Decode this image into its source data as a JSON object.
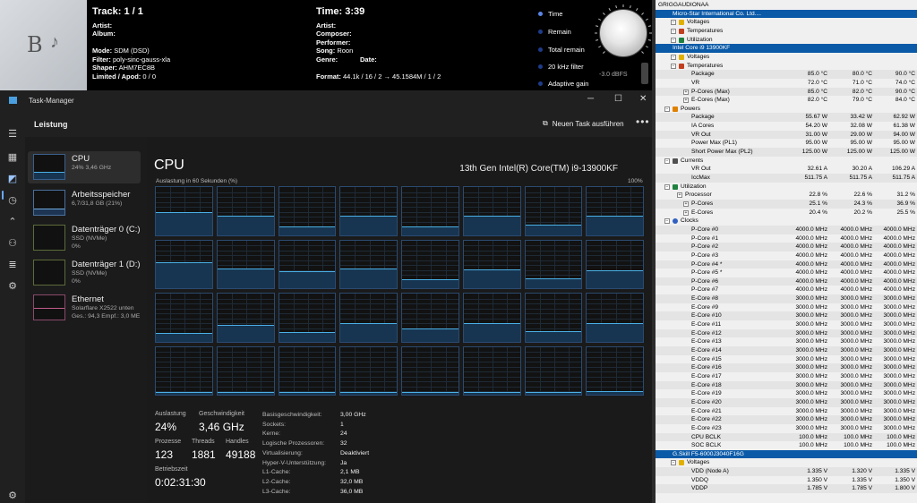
{
  "player": {
    "track_label": "Track:",
    "track_value": "1 / 1",
    "artist_label": "Artist:",
    "album_label": "Album:",
    "mode_label": "Mode:",
    "mode_value": "SDM (DSD)",
    "filter_label": "Filter:",
    "filter_value": "poly-sinc-gauss-xla",
    "shaper_label": "Shaper:",
    "shaper_value": "AHM7EC8B",
    "limited_label": "Limited / Apod:",
    "limited_value": "0 / 0",
    "time_label": "Time:",
    "time_value": "3:39",
    "composer_label": "Composer:",
    "performer_label": "Performer:",
    "song_label": "Song:",
    "song_value": "Roon",
    "genre_label": "Genre:",
    "date_label": "Date:",
    "format_label": "Format:",
    "format_value": "44.1k / 16 / 2 → 45.1584M / 1 / 2",
    "options": [
      "Time",
      "Remain",
      "Total remain",
      "20 kHz filter",
      "Adaptive gain"
    ],
    "selected_option_index": 0,
    "volume_text": "-3.0 dBFS"
  },
  "taskmanager": {
    "window_title": "Task-Manager",
    "section_title": "Leistung",
    "new_task_label": "Neuen Task ausführen",
    "more_label": "•••",
    "resources": [
      {
        "name": "CPU",
        "sub1": "24% 3,46 GHz",
        "sub2": ""
      },
      {
        "name": "Arbeitsspeicher",
        "sub1": "6,7/31,8 GB (21%)",
        "sub2": ""
      },
      {
        "name": "Datenträger 0 (C:)",
        "sub1": "SSD (NVMe)",
        "sub2": "0%"
      },
      {
        "name": "Datenträger 1 (D:)",
        "sub1": "SSD (NVMe)",
        "sub2": "0%"
      },
      {
        "name": "Ethernet",
        "sub1": "Solarflare X2522 unten",
        "sub2": "Ges.: 94,3 Empf.: 3,0 ME"
      }
    ],
    "cpu_title": "CPU",
    "cpu_model": "13th Gen Intel(R) Core(TM) i9-13900KF",
    "graph_caption": "Auslastung in 60 Sekunden (%)",
    "graph_max": "100%",
    "core_loads": [
      48,
      40,
      18,
      40,
      18,
      40,
      22,
      40,
      55,
      42,
      35,
      42,
      18,
      40,
      20,
      38,
      18,
      35,
      20,
      38,
      28,
      38,
      22,
      38,
      5,
      6,
      5,
      6,
      5,
      5,
      6,
      7
    ],
    "stats": {
      "util_label": "Auslastung",
      "util_value": "24%",
      "speed_label": "Geschwindigkeit",
      "speed_value": "3,46 GHz",
      "proc_label": "Prozesse",
      "proc_value": "123",
      "threads_label": "Threads",
      "threads_value": "1881",
      "handles_label": "Handles",
      "handles_value": "49188",
      "uptime_label": "Betriebszeit",
      "uptime_value": "0:02:31:30"
    },
    "specs": [
      {
        "label": "Basisgeschwindigkeit:",
        "value": "3,00 GHz"
      },
      {
        "label": "Sockets:",
        "value": "1"
      },
      {
        "label": "Kerne:",
        "value": "24"
      },
      {
        "label": "Logische Prozessoren:",
        "value": "32"
      },
      {
        "label": "Virtualisierung:",
        "value": "Deaktiviert"
      },
      {
        "label": "Hyper-V-Unterstützung:",
        "value": "Ja"
      },
      {
        "label": "L1-Cache:",
        "value": "2,1 MB"
      },
      {
        "label": "L2-Cache:",
        "value": "32,0 MB"
      },
      {
        "label": "L3-Cache:",
        "value": "36,0 MB"
      }
    ]
  },
  "hwinfo": {
    "rows": [
      {
        "name": "GRIGGAUDIONAA",
        "indent": 0,
        "kind": "root"
      },
      {
        "name": "Micro-Star International Co. Ltd....",
        "indent": 1,
        "kind": "sel"
      },
      {
        "name": "Voltages",
        "indent": 2,
        "kind": "group",
        "icon": "bolt-icon"
      },
      {
        "name": "Temperatures",
        "indent": 2,
        "kind": "group",
        "icon": "thermometer-icon"
      },
      {
        "name": "Utilization",
        "indent": 2,
        "kind": "group",
        "icon": "chip-icon"
      },
      {
        "name": "Intel Core i9 13900KF",
        "indent": 1,
        "kind": "sel"
      },
      {
        "name": "Voltages",
        "indent": 2,
        "kind": "group",
        "icon": "bolt-icon"
      },
      {
        "name": "Temperatures",
        "indent": 2,
        "kind": "group",
        "icon": "thermometer-icon"
      },
      {
        "name": "Package",
        "indent": 4,
        "v": [
          "85.0 °C",
          "80.0 °C",
          "90.0 °C"
        ]
      },
      {
        "name": "VR",
        "indent": 4,
        "v": [
          "72.0 °C",
          "71.0 °C",
          "74.0 °C"
        ]
      },
      {
        "name": "P-Cores (Max)",
        "indent": 4,
        "exp": true,
        "v": [
          "85.0 °C",
          "82.0 °C",
          "90.0 °C"
        ]
      },
      {
        "name": "E-Cores (Max)",
        "indent": 4,
        "exp": true,
        "v": [
          "82.0 °C",
          "79.0 °C",
          "84.0 °C"
        ]
      },
      {
        "name": "Powers",
        "indent": 1,
        "kind": "group",
        "icon": "power-icon"
      },
      {
        "name": "Package",
        "indent": 4,
        "v": [
          "55.67 W",
          "33.42 W",
          "62.92 W"
        ]
      },
      {
        "name": "IA Cores",
        "indent": 4,
        "v": [
          "54.20 W",
          "32.08 W",
          "61.38 W"
        ]
      },
      {
        "name": "VR Out",
        "indent": 4,
        "v": [
          "31.00 W",
          "29.00 W",
          "94.00 W"
        ]
      },
      {
        "name": "Power Max (PL1)",
        "indent": 4,
        "v": [
          "95.00 W",
          "95.00 W",
          "95.00 W"
        ]
      },
      {
        "name": "Short Power Max (PL2)",
        "indent": 4,
        "v": [
          "125.00 W",
          "125.00 W",
          "125.00 W"
        ]
      },
      {
        "name": "Currents",
        "indent": 1,
        "kind": "group",
        "icon": "current-icon"
      },
      {
        "name": "VR Out",
        "indent": 4,
        "v": [
          "32.61 A",
          "30.20 A",
          "106.29 A"
        ]
      },
      {
        "name": "IccMax",
        "indent": 4,
        "v": [
          "511.75 A",
          "511.75 A",
          "511.75 A"
        ]
      },
      {
        "name": "Utilization",
        "indent": 1,
        "kind": "group",
        "icon": "chip-icon"
      },
      {
        "name": "Processor",
        "indent": 3,
        "exp": true,
        "v": [
          "22.8 %",
          "22.6 %",
          "31.2 %"
        ]
      },
      {
        "name": "P-Cores",
        "indent": 4,
        "exp": true,
        "v": [
          "25.1 %",
          "24.3 %",
          "36.9 %"
        ]
      },
      {
        "name": "E-Cores",
        "indent": 4,
        "exp": true,
        "v": [
          "20.4 %",
          "20.2 %",
          "25.5 %"
        ]
      },
      {
        "name": "Clocks",
        "indent": 1,
        "kind": "group",
        "icon": "clock-icon"
      },
      {
        "name": "P-Core #0",
        "indent": 4,
        "v": [
          "4000.0 MHz",
          "4000.0 MHz",
          "4000.0 MHz"
        ]
      },
      {
        "name": "P-Core #1",
        "indent": 4,
        "v": [
          "4000.0 MHz",
          "4000.0 MHz",
          "4000.0 MHz"
        ]
      },
      {
        "name": "P-Core #2",
        "indent": 4,
        "v": [
          "4000.0 MHz",
          "4000.0 MHz",
          "4000.0 MHz"
        ]
      },
      {
        "name": "P-Core #3",
        "indent": 4,
        "v": [
          "4000.0 MHz",
          "4000.0 MHz",
          "4000.0 MHz"
        ]
      },
      {
        "name": "P-Core #4 *",
        "indent": 4,
        "v": [
          "4000.0 MHz",
          "4000.0 MHz",
          "4000.0 MHz"
        ]
      },
      {
        "name": "P-Core #5 *",
        "indent": 4,
        "v": [
          "4000.0 MHz",
          "4000.0 MHz",
          "4000.0 MHz"
        ]
      },
      {
        "name": "P-Core #6",
        "indent": 4,
        "v": [
          "4000.0 MHz",
          "4000.0 MHz",
          "4000.0 MHz"
        ]
      },
      {
        "name": "P-Core #7",
        "indent": 4,
        "v": [
          "4000.0 MHz",
          "4000.0 MHz",
          "4000.0 MHz"
        ]
      },
      {
        "name": "E-Core #8",
        "indent": 4,
        "v": [
          "3000.0 MHz",
          "3000.0 MHz",
          "3000.0 MHz"
        ]
      },
      {
        "name": "E-Core #9",
        "indent": 4,
        "v": [
          "3000.0 MHz",
          "3000.0 MHz",
          "3000.0 MHz"
        ]
      },
      {
        "name": "E-Core #10",
        "indent": 4,
        "v": [
          "3000.0 MHz",
          "3000.0 MHz",
          "3000.0 MHz"
        ]
      },
      {
        "name": "E-Core #11",
        "indent": 4,
        "v": [
          "3000.0 MHz",
          "3000.0 MHz",
          "3000.0 MHz"
        ]
      },
      {
        "name": "E-Core #12",
        "indent": 4,
        "v": [
          "3000.0 MHz",
          "3000.0 MHz",
          "3000.0 MHz"
        ]
      },
      {
        "name": "E-Core #13",
        "indent": 4,
        "v": [
          "3000.0 MHz",
          "3000.0 MHz",
          "3000.0 MHz"
        ]
      },
      {
        "name": "E-Core #14",
        "indent": 4,
        "v": [
          "3000.0 MHz",
          "3000.0 MHz",
          "3000.0 MHz"
        ]
      },
      {
        "name": "E-Core #15",
        "indent": 4,
        "v": [
          "3000.0 MHz",
          "3000.0 MHz",
          "3000.0 MHz"
        ]
      },
      {
        "name": "E-Core #16",
        "indent": 4,
        "v": [
          "3000.0 MHz",
          "3000.0 MHz",
          "3000.0 MHz"
        ]
      },
      {
        "name": "E-Core #17",
        "indent": 4,
        "v": [
          "3000.0 MHz",
          "3000.0 MHz",
          "3000.0 MHz"
        ]
      },
      {
        "name": "E-Core #18",
        "indent": 4,
        "v": [
          "3000.0 MHz",
          "3000.0 MHz",
          "3000.0 MHz"
        ]
      },
      {
        "name": "E-Core #19",
        "indent": 4,
        "v": [
          "3000.0 MHz",
          "3000.0 MHz",
          "3000.0 MHz"
        ]
      },
      {
        "name": "E-Core #20",
        "indent": 4,
        "v": [
          "3000.0 MHz",
          "3000.0 MHz",
          "3000.0 MHz"
        ]
      },
      {
        "name": "E-Core #21",
        "indent": 4,
        "v": [
          "3000.0 MHz",
          "3000.0 MHz",
          "3000.0 MHz"
        ]
      },
      {
        "name": "E-Core #22",
        "indent": 4,
        "v": [
          "3000.0 MHz",
          "3000.0 MHz",
          "3000.0 MHz"
        ]
      },
      {
        "name": "E-Core #23",
        "indent": 4,
        "v": [
          "3000.0 MHz",
          "3000.0 MHz",
          "3000.0 MHz"
        ]
      },
      {
        "name": "CPU BCLK",
        "indent": 4,
        "v": [
          "100.0 MHz",
          "100.0 MHz",
          "100.0 MHz"
        ]
      },
      {
        "name": "SOC BCLK",
        "indent": 4,
        "v": [
          "100.0 MHz",
          "100.0 MHz",
          "100.0 MHz"
        ]
      },
      {
        "name": "G.Skill F5-6000J3040F16G",
        "indent": 1,
        "kind": "sel"
      },
      {
        "name": "Voltages",
        "indent": 2,
        "kind": "group",
        "icon": "bolt-icon"
      },
      {
        "name": "VDD (Node A)",
        "indent": 4,
        "v": [
          "1.335 V",
          "1.320 V",
          "1.335 V"
        ]
      },
      {
        "name": "VDDQ",
        "indent": 4,
        "v": [
          "1.350 V",
          "1.335 V",
          "1.350 V"
        ]
      },
      {
        "name": "VDDP",
        "indent": 4,
        "v": [
          "1.785 V",
          "1.785 V",
          "1.800 V"
        ]
      }
    ]
  }
}
